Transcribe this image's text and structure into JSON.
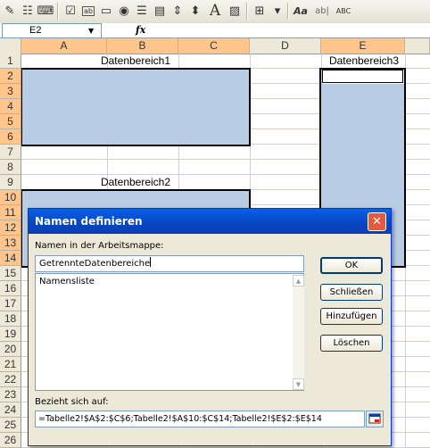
{
  "toolbar": {
    "icons": [
      "draw-icon",
      "properties-icon",
      "code-icon",
      "checkbox-icon",
      "textfield-icon",
      "button-icon",
      "radio-icon",
      "listbox-icon",
      "combobox-icon",
      "scrollbar-icon",
      "spinner-icon",
      "label-icon",
      "image-icon",
      "toggle-grid-icon",
      "more-icon",
      "text-format-icon",
      "text-style-icon",
      "spelling-icon"
    ]
  },
  "formula_bar": {
    "name_box": "E2",
    "fx": "fx"
  },
  "grid": {
    "columns": [
      "A",
      "B",
      "C",
      "D",
      "E"
    ],
    "rows": [
      "1",
      "2",
      "3",
      "4",
      "5",
      "6",
      "7",
      "8",
      "9",
      "10",
      "11",
      "12",
      "13",
      "14",
      "15",
      "16",
      "17",
      "18",
      "19",
      "20",
      "21",
      "22",
      "23",
      "24",
      "25",
      "26"
    ],
    "labels": {
      "range1": "Datenbereich1",
      "range2": "Datenbereich2",
      "range3": "Datenbereich3"
    }
  },
  "dialog": {
    "title": "Namen definieren",
    "names_label": "Namen in der Arbeitsmappe:",
    "name_value": "GetrennteDatenbereiche",
    "list_items": [
      "Namensliste"
    ],
    "refers_label": "Bezieht sich auf:",
    "refers_value": "=Tabelle2!$A$2:$C$6;Tabelle2!$A$10:$C$14;Tabelle2!$E$2:$E$14",
    "buttons": {
      "ok": "OK",
      "close": "Schließen",
      "add": "Hinzufügen",
      "delete": "Löschen"
    },
    "close_glyph": "✕"
  },
  "colors": {
    "selection_fill": "#b8cce4",
    "header_highlight": "#ffc58a",
    "title_bar": "#0a5fe8"
  }
}
